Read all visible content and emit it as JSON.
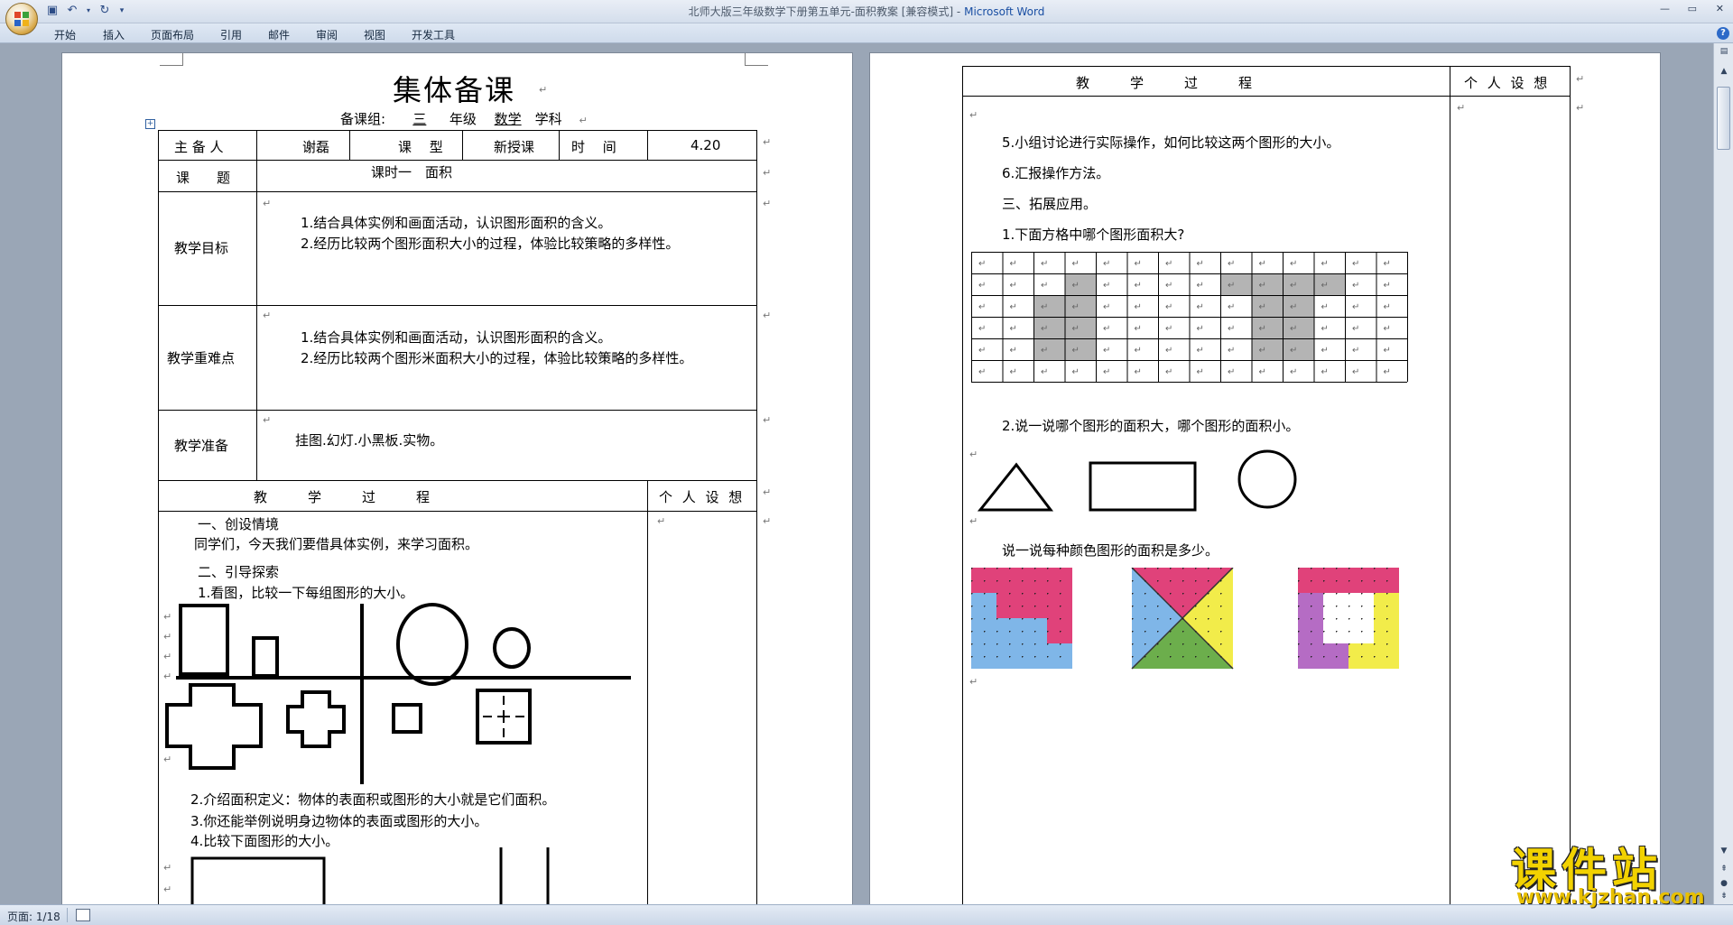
{
  "window": {
    "title": "北师大版三年级数学下册第五单元-面积教案 [兼容模式] - ",
    "app_name": "Microsoft Word"
  },
  "ribbon_tabs": [
    "开始",
    "插入",
    "页面布局",
    "引用",
    "邮件",
    "审阅",
    "视图",
    "开发工具"
  ],
  "status": {
    "page": "页面: 1/18"
  },
  "page1": {
    "heading": "集体备课",
    "subheading": {
      "label": "备课组:",
      "grade_num": "三",
      "grade": "年级",
      "subject": "数学",
      "subject_suffix": "学科"
    },
    "info": {
      "lead_label": "主 备 人",
      "lead": "谢磊",
      "type_label": "课　 型",
      "type": "新授课",
      "time_label": "时　 间",
      "time": "4.20",
      "topic_label": "课　　题",
      "topic": "课时一　面积"
    },
    "goals_label": "教学目标",
    "goals": [
      "1.结合具体实例和画面活动，认识图形面积的含义。",
      "2.经历比较两个图形面积大小的过程，体验比较策略的多样性。"
    ],
    "key_label": "教学重难点",
    "key_points": [
      "1.结合具体实例和画面活动，认识图形面积的含义。",
      "2.经历比较两个图形米面积大小的过程，体验比较策略的多样性。"
    ],
    "prep_label": "教学准备",
    "prep": "挂图.幻灯.小黑板.实物。",
    "process_header": "教　　　学　　　过　　　程",
    "notes_header": "个 人 设 想",
    "process": [
      "一、创设情境",
      "同学们，今天我们要借具体实例，来学习面积。",
      "二、引导探索",
      "1.看图，比较一下每组图形的大小。",
      "2.介绍面积定义：物体的表面积或图形的大小就是它们面积。",
      "3.你还能举例说明身边物体的表面或图形的大小。",
      "4.比较下面图形的大小。"
    ]
  },
  "page2": {
    "process_header": "教　　　学　　　过　　　程",
    "notes_header": "个 人 设 想",
    "lines": [
      "5.小组讨论进行实际操作，如何比较这两个图形的大小。",
      "6.汇报操作方法。",
      "三、拓展应用。",
      "1.下面方格中哪个图形面积大?",
      "2.说一说哪个图形的面积大，哪个图形的面积小。",
      "说一说每种颜色图形的面积是多少。"
    ]
  },
  "watermark": {
    "cn": "课件站",
    "url": "www.kjzhan.com"
  },
  "colors": {
    "pink": "#e0427a",
    "blue": "#7fb6e8",
    "yellow": "#f2ec4a",
    "green": "#6cae4c",
    "purple": "#b56cc4",
    "grid_fill": "#b4b4b4"
  }
}
